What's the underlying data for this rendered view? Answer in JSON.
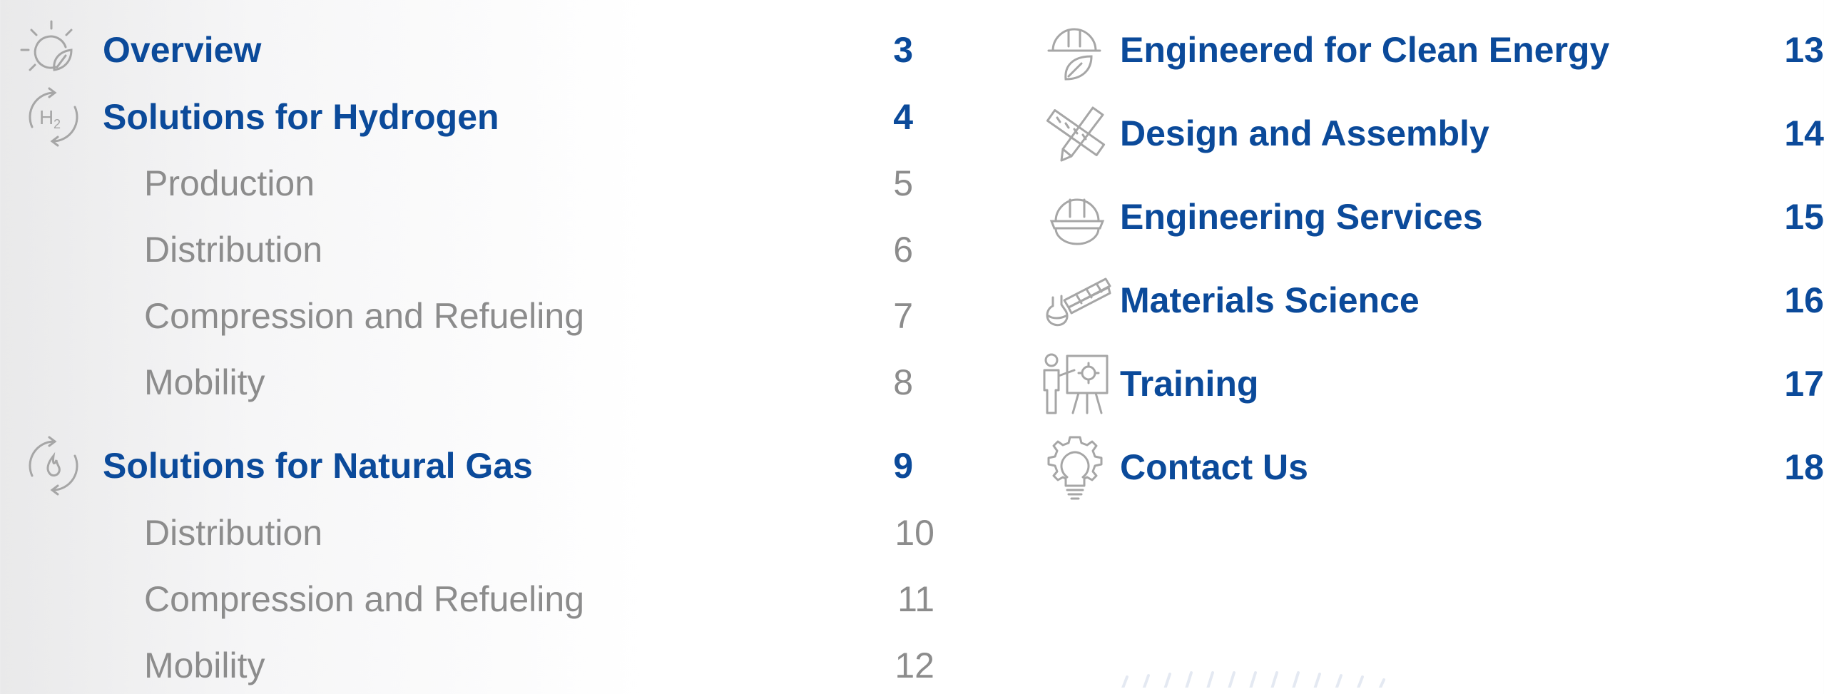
{
  "colors": {
    "heading": "#0b4a9a",
    "subheading": "#8c8c8c",
    "icon": "#a6a6a6"
  },
  "left_column": {
    "overview": {
      "icon": "sun-leaf-icon",
      "title": "Overview",
      "page": "3"
    },
    "hydrogen": {
      "icon": "h2-cycle-icon",
      "title": "Solutions for Hydrogen",
      "page": "4",
      "items": [
        {
          "title": "Production",
          "page": "5"
        },
        {
          "title": "Distribution",
          "page": "6"
        },
        {
          "title": "Compression and Refueling",
          "page": "7"
        },
        {
          "title": "Mobility",
          "page": "8"
        }
      ]
    },
    "natural_gas": {
      "icon": "flame-cycle-icon",
      "title": "Solutions for Natural Gas",
      "page": "9",
      "items": [
        {
          "title": "Distribution",
          "page": "10"
        },
        {
          "title": "Compression and Refueling",
          "page": "11"
        },
        {
          "title": "Mobility",
          "page": "12"
        }
      ]
    }
  },
  "right_column": [
    {
      "icon": "hardhat-leaf-icon",
      "title": "Engineered for Clean Energy",
      "page": "13"
    },
    {
      "icon": "ruler-pencil-icon",
      "title": "Design and Assembly",
      "page": "14"
    },
    {
      "icon": "hardhat-icon",
      "title": "Engineering Services",
      "page": "15"
    },
    {
      "icon": "flask-tubes-icon",
      "title": "Materials Science",
      "page": "16"
    },
    {
      "icon": "presenter-board-icon",
      "title": "Training",
      "page": "17"
    },
    {
      "icon": "gear-bulb-icon",
      "title": "Contact Us",
      "page": "18"
    }
  ]
}
